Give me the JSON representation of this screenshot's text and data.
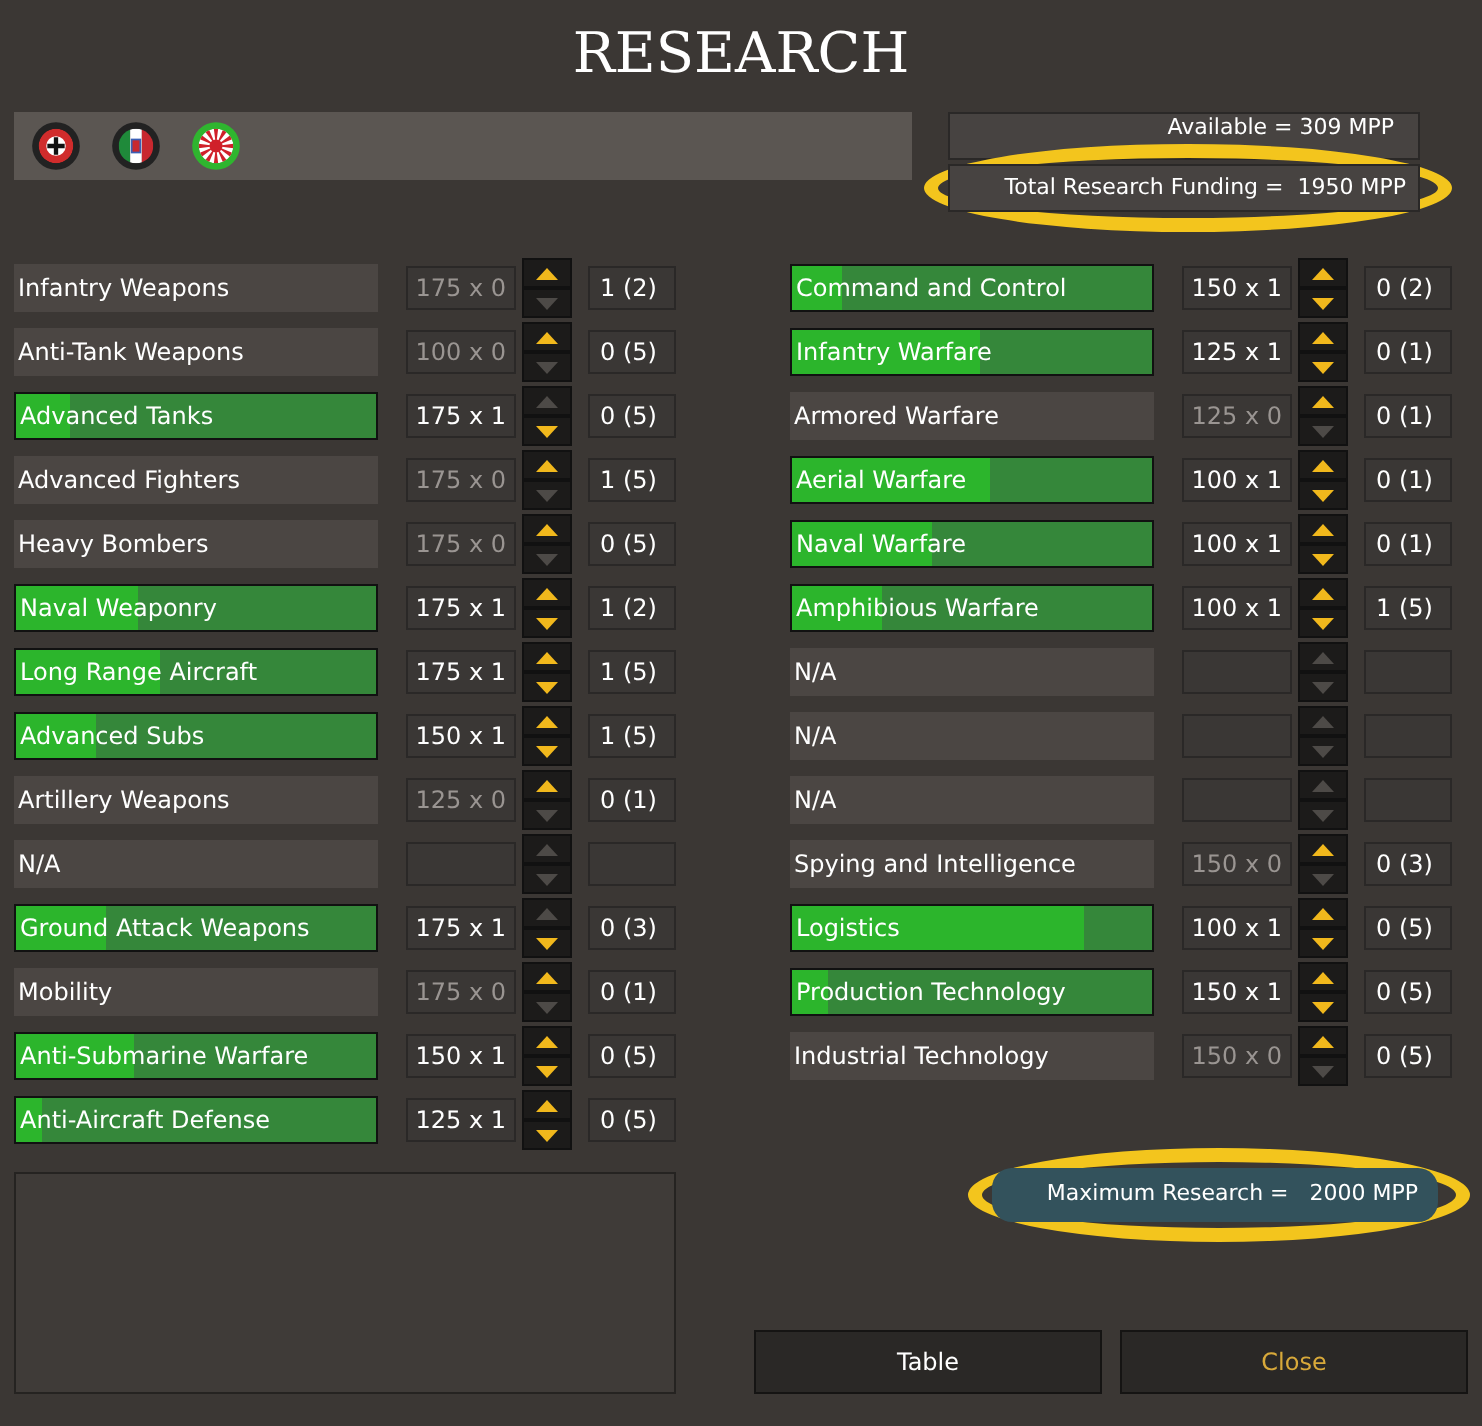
{
  "title": "RESEARCH",
  "flags": [
    {
      "selected": false
    },
    {
      "selected": false
    },
    {
      "selected": true
    }
  ],
  "available": {
    "text": "Available = 309 MPP"
  },
  "total_funding": {
    "text": "Total Research Funding =  1950 MPP",
    "highlighted": true
  },
  "columns": [
    {
      "items": [
        {
          "name": "Infantry Weapons",
          "active": false,
          "cost": "175 x 0",
          "up_enabled": true,
          "down_enabled": false,
          "value": "1 (2)"
        },
        {
          "name": "Anti-Tank Weapons",
          "active": false,
          "cost": "100 x 0",
          "up_enabled": true,
          "down_enabled": false,
          "value": "0 (5)"
        },
        {
          "name": "Advanced Tanks",
          "active": true,
          "level": 0.15,
          "cost": "175 x 1",
          "up_enabled": false,
          "down_enabled": true,
          "value": "0 (5)"
        },
        {
          "name": "Advanced Fighters",
          "active": false,
          "cost": "175 x 0",
          "up_enabled": true,
          "down_enabled": false,
          "value": "1 (5)"
        },
        {
          "name": "Heavy Bombers",
          "active": false,
          "cost": "175 x 0",
          "up_enabled": true,
          "down_enabled": false,
          "value": "0 (5)"
        },
        {
          "name": "Naval Weaponry",
          "active": true,
          "level": 0.34,
          "cost": "175 x 1",
          "up_enabled": true,
          "down_enabled": true,
          "value": "1 (2)"
        },
        {
          "name": "Long Range Aircraft",
          "active": true,
          "level": 0.4,
          "cost": "175 x 1",
          "up_enabled": true,
          "down_enabled": true,
          "value": "1 (5)"
        },
        {
          "name": "Advanced Subs",
          "active": true,
          "level": 0.22,
          "cost": "150 x 1",
          "up_enabled": true,
          "down_enabled": true,
          "value": "1 (5)"
        },
        {
          "name": "Artillery Weapons",
          "active": false,
          "cost": "125 x 0",
          "up_enabled": true,
          "down_enabled": false,
          "value": "0 (1)"
        },
        {
          "name": "N/A",
          "active": false,
          "up_enabled": false,
          "down_enabled": false
        },
        {
          "name": "Ground Attack Weapons",
          "active": true,
          "level": 0.25,
          "cost": "175 x 1",
          "up_enabled": false,
          "down_enabled": true,
          "value": "0 (3)"
        },
        {
          "name": "Mobility",
          "active": false,
          "cost": "175 x 0",
          "up_enabled": true,
          "down_enabled": false,
          "value": "0 (1)"
        },
        {
          "name": "Anti-Submarine Warfare",
          "active": true,
          "level": 0.33,
          "cost": "150 x 1",
          "up_enabled": true,
          "down_enabled": true,
          "value": "0 (5)"
        },
        {
          "name": "Anti-Aircraft Defense",
          "active": true,
          "level": 0.07,
          "cost": "125 x 1",
          "up_enabled": true,
          "down_enabled": true,
          "value": "0 (5)"
        }
      ]
    },
    {
      "items": [
        {
          "name": "Command and Control",
          "active": true,
          "level": 0.14,
          "cost": "150 x 1",
          "up_enabled": true,
          "down_enabled": true,
          "value": "0 (2)"
        },
        {
          "name": "Infantry Warfare",
          "active": true,
          "level": 0.52,
          "cost": "125 x 1",
          "up_enabled": true,
          "down_enabled": true,
          "value": "0 (1)"
        },
        {
          "name": "Armored Warfare",
          "active": false,
          "cost": "125 x 0",
          "up_enabled": true,
          "down_enabled": false,
          "value": "0 (1)"
        },
        {
          "name": "Aerial Warfare",
          "active": true,
          "level": 0.55,
          "cost": "100 x 1",
          "up_enabled": true,
          "down_enabled": true,
          "value": "0 (1)"
        },
        {
          "name": "Naval Warfare",
          "active": true,
          "level": 0.39,
          "cost": "100 x 1",
          "up_enabled": true,
          "down_enabled": true,
          "value": "0 (1)"
        },
        {
          "name": "Amphibious Warfare",
          "active": true,
          "level": 0.25,
          "cost": "100 x 1",
          "up_enabled": true,
          "down_enabled": true,
          "value": "1 (5)"
        },
        {
          "name": "N/A",
          "active": false,
          "up_enabled": false,
          "down_enabled": false
        },
        {
          "name": "N/A",
          "active": false,
          "up_enabled": false,
          "down_enabled": false
        },
        {
          "name": "N/A",
          "active": false,
          "up_enabled": false,
          "down_enabled": false
        },
        {
          "name": "Spying and Intelligence",
          "active": false,
          "cost": "150 x 0",
          "up_enabled": true,
          "down_enabled": false,
          "value": "0 (3)"
        },
        {
          "name": "Logistics",
          "active": true,
          "level": 0.81,
          "cost": "100 x 1",
          "up_enabled": true,
          "down_enabled": true,
          "value": "0 (5)"
        },
        {
          "name": "Production Technology",
          "active": true,
          "level": 0.1,
          "cost": "150 x 1",
          "up_enabled": true,
          "down_enabled": true,
          "value": "0 (5)"
        },
        {
          "name": "Industrial Technology",
          "active": false,
          "cost": "150 x 0",
          "up_enabled": true,
          "down_enabled": false,
          "value": "0 (5)"
        }
      ]
    }
  ],
  "maximum_research": {
    "text": "Maximum Research =   2000 MPP",
    "highlighted": true
  },
  "buttons": [
    {
      "label": "Table",
      "kind": "normal"
    },
    {
      "label": "Close",
      "kind": "close"
    }
  ]
}
